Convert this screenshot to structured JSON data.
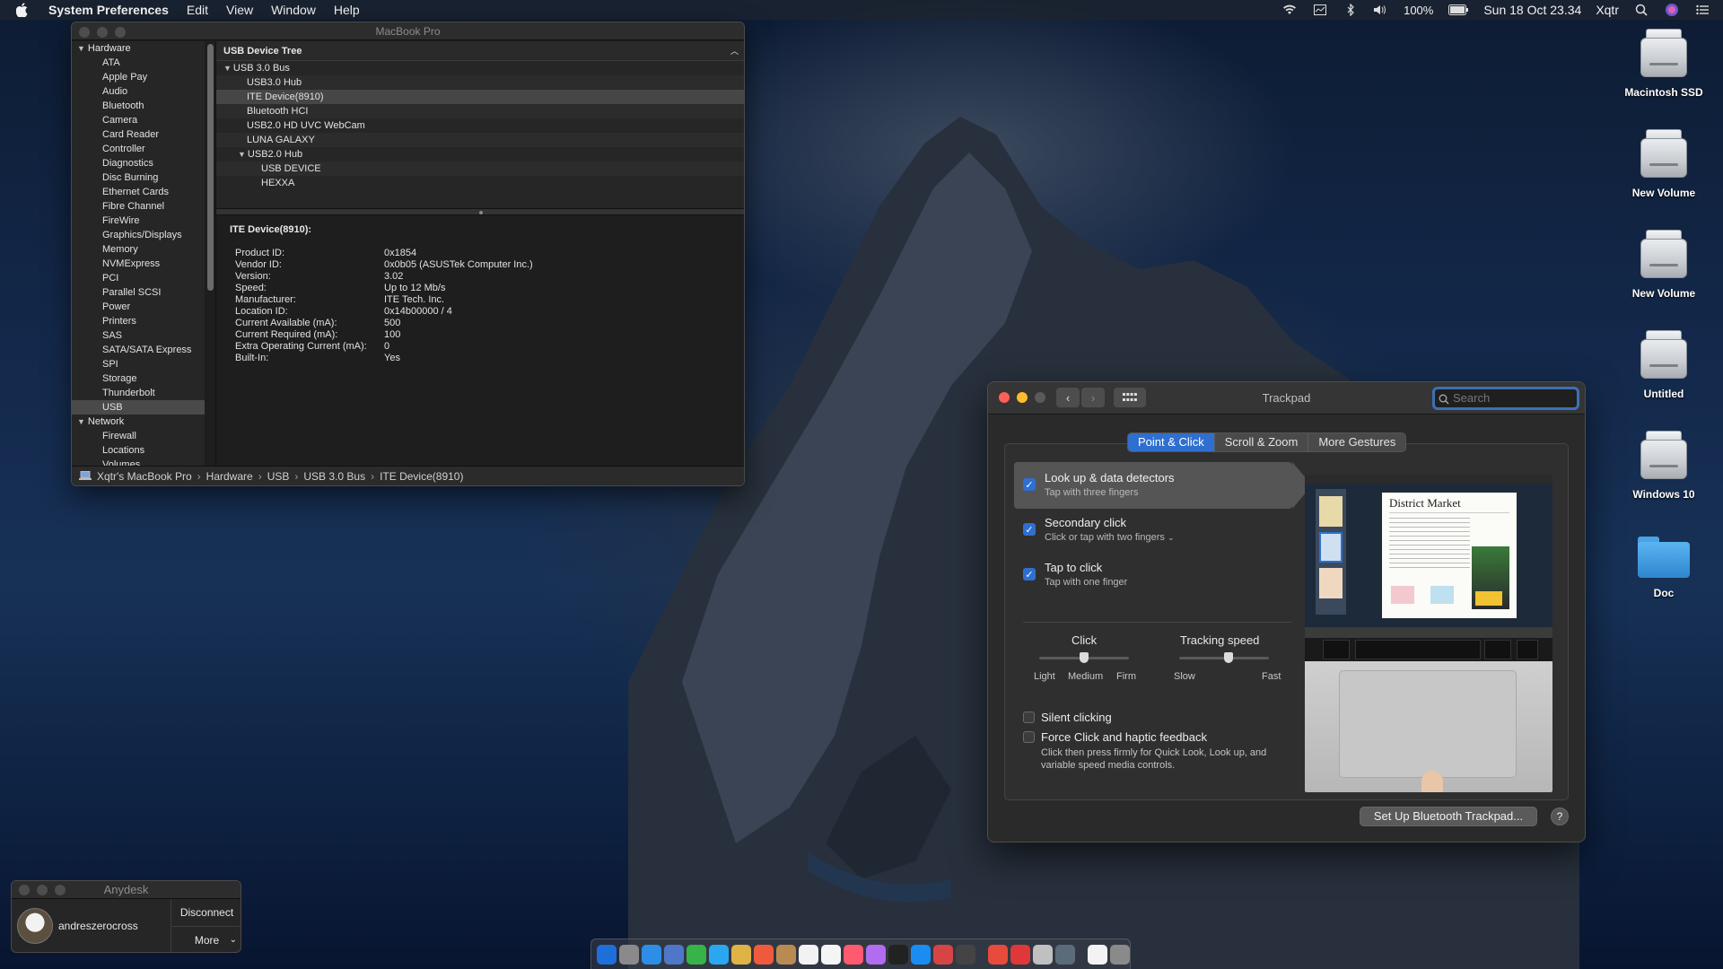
{
  "menubar": {
    "app_name": "System Preferences",
    "items": [
      "Edit",
      "View",
      "Window",
      "Help"
    ],
    "battery": "100%",
    "datetime": "Sun 18 Oct  23.34",
    "user": "Xqtr"
  },
  "desktop_icons": [
    {
      "label": "Macintosh SSD",
      "kind": "disk"
    },
    {
      "label": "New Volume",
      "kind": "disk"
    },
    {
      "label": "New Volume",
      "kind": "disk"
    },
    {
      "label": "Untitled",
      "kind": "disk"
    },
    {
      "label": "Windows 10",
      "kind": "disk"
    },
    {
      "label": "Doc",
      "kind": "folder"
    }
  ],
  "sysinfo": {
    "title": "MacBook Pro",
    "sidebar": {
      "hardware_header": "Hardware",
      "hardware_items": [
        "ATA",
        "Apple Pay",
        "Audio",
        "Bluetooth",
        "Camera",
        "Card Reader",
        "Controller",
        "Diagnostics",
        "Disc Burning",
        "Ethernet Cards",
        "Fibre Channel",
        "FireWire",
        "Graphics/Displays",
        "Memory",
        "NVMExpress",
        "PCI",
        "Parallel SCSI",
        "Power",
        "Printers",
        "SAS",
        "SATA/SATA Express",
        "SPI",
        "Storage",
        "Thunderbolt",
        "USB"
      ],
      "selected": "USB",
      "network_header": "Network",
      "network_items": [
        "Firewall",
        "Locations",
        "Volumes"
      ]
    },
    "tree_header": "USB Device Tree",
    "tree": [
      {
        "label": "USB 3.0 Bus",
        "level": 0,
        "expanded": true
      },
      {
        "label": "USB3.0 Hub",
        "level": 1
      },
      {
        "label": "ITE Device(8910)",
        "level": 1,
        "selected": true
      },
      {
        "label": "Bluetooth HCI",
        "level": 1
      },
      {
        "label": "USB2.0 HD UVC WebCam",
        "level": 1
      },
      {
        "label": "LUNA  GALAXY",
        "level": 1
      },
      {
        "label": "USB2.0 Hub",
        "level": 1,
        "expanded": true
      },
      {
        "label": "USB DEVICE",
        "level": 2
      },
      {
        "label": "HEXXA",
        "level": 2
      }
    ],
    "detail_title": "ITE Device(8910):",
    "detail": [
      {
        "k": "Product ID:",
        "v": "0x1854"
      },
      {
        "k": "Vendor ID:",
        "v": "0x0b05  (ASUSTek Computer Inc.)"
      },
      {
        "k": "Version:",
        "v": "3.02"
      },
      {
        "k": "Speed:",
        "v": "Up to 12 Mb/s"
      },
      {
        "k": "Manufacturer:",
        "v": "ITE Tech. Inc."
      },
      {
        "k": "Location ID:",
        "v": "0x14b00000 / 4"
      },
      {
        "k": "Current Available (mA):",
        "v": "500"
      },
      {
        "k": "Current Required (mA):",
        "v": "100"
      },
      {
        "k": "Extra Operating Current (mA):",
        "v": "0"
      },
      {
        "k": "Built-In:",
        "v": "Yes"
      }
    ],
    "path": [
      "Xqtr's MacBook Pro",
      "Hardware",
      "USB",
      "USB 3.0 Bus",
      "ITE Device(8910)"
    ]
  },
  "trackpad": {
    "title": "Trackpad",
    "search_placeholder": "Search",
    "tabs": [
      "Point & Click",
      "Scroll & Zoom",
      "More Gestures"
    ],
    "active_tab": "Point & Click",
    "options": [
      {
        "title": "Look up & data detectors",
        "sub": "Tap with three fingers",
        "checked": true,
        "selected": true
      },
      {
        "title": "Secondary click",
        "sub": "Click or tap with two fingers",
        "checked": true,
        "dropdown": true
      },
      {
        "title": "Tap to click",
        "sub": "Tap with one finger",
        "checked": true
      }
    ],
    "click": {
      "label": "Click",
      "ticks": [
        "Light",
        "Medium",
        "Firm"
      ],
      "value": "Medium"
    },
    "tracking": {
      "label": "Tracking speed",
      "ticks": [
        "Slow",
        "Fast"
      ],
      "value_fraction": 0.55
    },
    "silent_clicking": "Silent clicking",
    "force_click": "Force Click and haptic feedback",
    "force_click_sub": "Click then press firmly for Quick Look, Look up, and variable speed media controls.",
    "preview_doc_title": "District Market",
    "setup_button": "Set Up Bluetooth Trackpad...",
    "help": "?"
  },
  "anydesk": {
    "title": "Anydesk",
    "user": "andreszerocross",
    "disconnect": "Disconnect",
    "more": "More"
  },
  "dock": {
    "colors": [
      "#1e6fd9",
      "#8a8a8a",
      "#2e8de6",
      "#4f77c9",
      "#36b44a",
      "#2aa7f0",
      "#e0b347",
      "#f05a3c",
      "#b98b52",
      "#f2f2f2",
      "#f5f5f5",
      "#ff5a6e",
      "#b26cf0",
      "#222222",
      "#1b8cf2",
      "#d64545",
      "#444444",
      "#e84a3b",
      "#e03838",
      "#c0c0c0",
      "#5c6b7a",
      "#f3f3f3",
      "#8a8a8a"
    ]
  }
}
